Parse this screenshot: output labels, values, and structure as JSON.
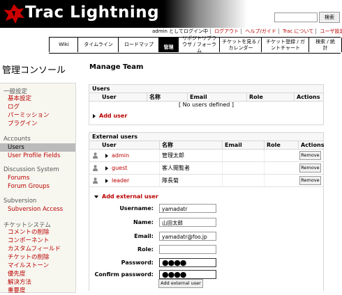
{
  "header": {
    "logo_text": "Trac Lightning",
    "search_button": "検索",
    "search_value": ""
  },
  "metanav": {
    "login_status": "admin としてログイン中",
    "logout": "ログアウト",
    "help": "ヘルプ/ガイド",
    "about": "Trac について",
    "prefs": "ユーザ設定"
  },
  "mainnav": {
    "tabs": [
      {
        "label": "Wiki"
      },
      {
        "label": "タイムライン"
      },
      {
        "label": "ロードマップ"
      },
      {
        "label": "リポジトリブラウザ / フォーラム"
      },
      {
        "label": "チケットを見る / カレンダー"
      },
      {
        "label": "チケット登録 / ガントチャート"
      },
      {
        "label": "検索 / 統計"
      }
    ],
    "active_label": "管理"
  },
  "sidebar": {
    "title": "管理コンソール",
    "groups": [
      {
        "label": "一般設定",
        "items": [
          "基本設定",
          "ログ",
          "パーミッション",
          "プラグイン"
        ]
      },
      {
        "label": "Accounts",
        "items": [
          "Users",
          "User Profile Fields"
        ]
      },
      {
        "label": "Discussion System",
        "items": [
          "Forums",
          "Forum Groups"
        ]
      },
      {
        "label": "Subversion",
        "items": [
          "Subversion Access"
        ]
      },
      {
        "label": "チケットシステム",
        "items": [
          "コメントの削除",
          "コンポーネント",
          "カスタムフィールド",
          "チケットの削除",
          "マイルストーン",
          "優先度",
          "解決方法",
          "重要度"
        ]
      }
    ],
    "active_item": "Users"
  },
  "main": {
    "title": "Manage Team",
    "users_box": {
      "heading": "Users",
      "columns": [
        "User",
        "名称",
        "Email",
        "Role",
        "Actions"
      ],
      "empty_text": "[ No users defined ]",
      "add_user": "Add user"
    },
    "external_box": {
      "heading": "External users",
      "columns": [
        "User",
        "名称",
        "Email",
        "Role",
        "Actions"
      ],
      "rows": [
        {
          "user": "admin",
          "name": "管理太郎",
          "email": "",
          "role": "",
          "action": "Remove"
        },
        {
          "user": "guest",
          "name": "客人閲覧者",
          "email": "",
          "role": "",
          "action": "Remove"
        },
        {
          "user": "leader",
          "name": "隊長菊",
          "email": "",
          "role": "",
          "action": "Remove"
        }
      ],
      "add_external_user": "Add external user"
    },
    "form": {
      "username_label": "Username:",
      "username_value": "yamadatr",
      "name_label": "Name:",
      "name_value": "山田太郎",
      "email_label": "Email:",
      "email_value": "yamadatr@foo.jp",
      "role_label": "Role:",
      "role_value": "",
      "password_label": "Password:",
      "password_value": "●●●●",
      "confirm_label": "Confirm password:",
      "confirm_value": "●●●●",
      "submit": "Add external user"
    }
  }
}
